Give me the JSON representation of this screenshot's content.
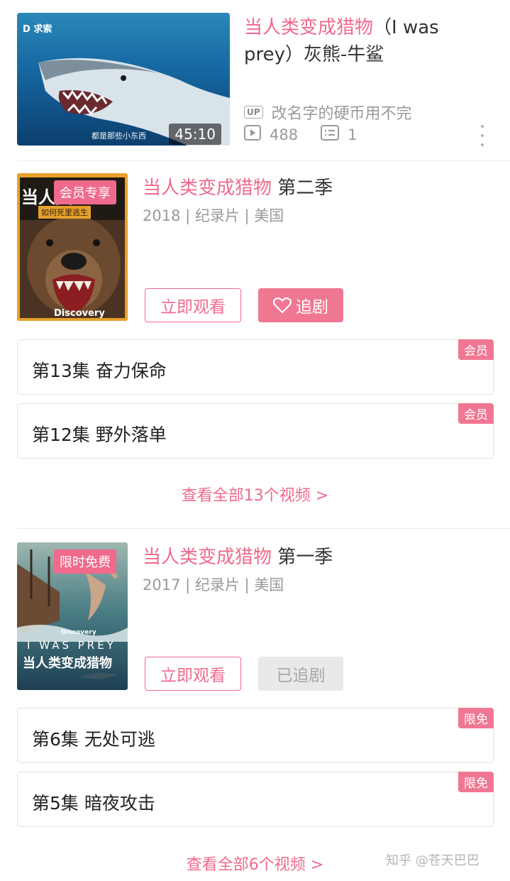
{
  "video": {
    "channel_logo": "D 求索",
    "thumb_caption": "都是那些小东西",
    "duration": "45:10",
    "title_hl": "当人类变成猎物",
    "title_rest": "（I was prey）灰熊-牛鲨",
    "up_badge": "UP",
    "up_name": "改名字的硬币用不完",
    "plays": "488",
    "comments": "1",
    "icons": [
      "play-count-icon",
      "comment-icon",
      "more-icon"
    ]
  },
  "seasons": [
    {
      "title_hl": "当人类变成猎物",
      "title_rest": " 第二季",
      "meta": "2018 | 纪录片 | 美国",
      "badge": "会员专享",
      "poster_title": "当人类",
      "poster_sub": "如何死里逃生",
      "poster_brand": "Discovery",
      "watch_label": "立即观看",
      "follow_label": "追剧",
      "follow_state": "follow",
      "episodes": [
        {
          "label": "第13集 奋力保命",
          "tag": "会员"
        },
        {
          "label": "第12集 野外落单",
          "tag": "会员"
        }
      ],
      "view_all": "查看全部13个视频 >"
    },
    {
      "title_hl": "当人类变成猎物",
      "title_rest": " 第一季",
      "meta": "2017 | 纪录片 | 美国",
      "badge": "限时免费",
      "poster_brand": "Discovery",
      "poster_en": "I WAS PREY",
      "poster_title": "当人类变成猎物",
      "watch_label": "立即观看",
      "follow_label": "已追剧",
      "follow_state": "followed",
      "episodes": [
        {
          "label": "第6集 无处可逃",
          "tag": "限免"
        },
        {
          "label": "第5集 暗夜攻击",
          "tag": "限免"
        }
      ],
      "view_all": "查看全部6个视频 >"
    }
  ],
  "watermark": "知乎 @苍天巴巴",
  "colors": {
    "accent": "#f06a8c",
    "muted": "#999999",
    "followed_bg": "#e9e9e9"
  }
}
